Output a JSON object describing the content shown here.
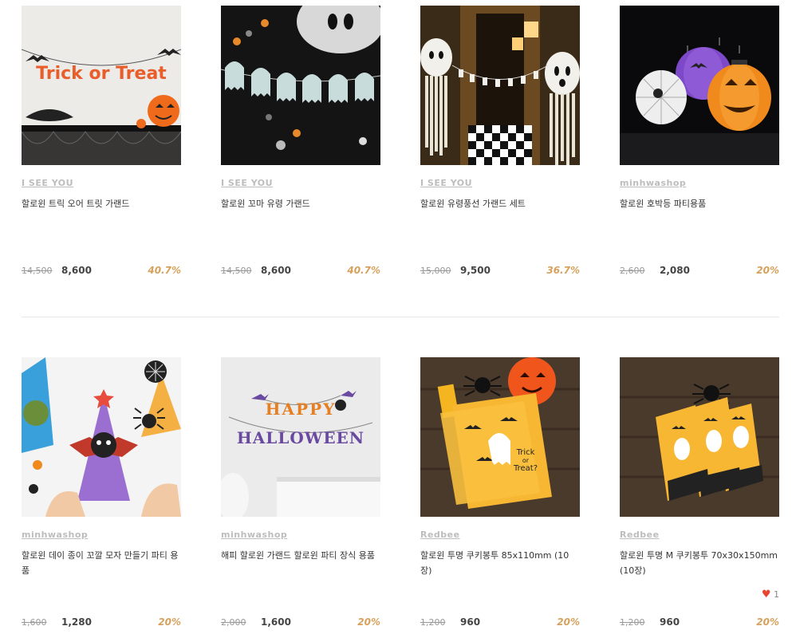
{
  "products_row1": [
    {
      "shop": "I SEE YOU",
      "title": "할로윈 트릭 오어 트릿 가랜드",
      "orig": "14,500",
      "sale": "8,600",
      "discount": "40.7%"
    },
    {
      "shop": "I SEE YOU",
      "title": "할로윈 꼬마 유령 가랜드",
      "orig": "14,500",
      "sale": "8,600",
      "discount": "40.7%"
    },
    {
      "shop": "I SEE YOU",
      "title": "할로윈 유령풍선 가랜드 세트",
      "orig": "15,000",
      "sale": "9,500",
      "discount": "36.7%"
    },
    {
      "shop": "minhwashop",
      "title": "할로윈 호박등 파티용품",
      "orig": "2,600",
      "sale": "2,080",
      "discount": "20%"
    }
  ],
  "products_row2": [
    {
      "shop": "minhwashop",
      "title": "할로윈 데이 종이 꼬깔 모자 만들기 파티 용품",
      "orig": "1,600",
      "sale": "1,280",
      "discount": "20%"
    },
    {
      "shop": "minhwashop",
      "title": "해피 할로윈 가랜드 할로윈 파티 장식 용품",
      "orig": "2,000",
      "sale": "1,600",
      "discount": "20%"
    },
    {
      "shop": "Redbee",
      "title": "할로윈 투명 쿠키봉투 85x110mm (10장)",
      "orig": "1,200",
      "sale": "960",
      "discount": "20%"
    },
    {
      "shop": "Redbee",
      "title": "할로윈 투명 M 쿠키봉투 70x30x150mm (10장)",
      "orig": "1,200",
      "sale": "960",
      "discount": "20%",
      "likes": "1"
    }
  ],
  "image_texts": {
    "trick_or_treat": "Trick or Treat",
    "happy": "HAPPY",
    "halloween": "HALLOWEEN",
    "bag_text_1": "Trick",
    "bag_text_2": "or",
    "bag_text_3": "Treat?"
  },
  "icons": {
    "like": "heart-icon"
  },
  "colors": {
    "discount": "#d6a15c",
    "shop_link": "#bdbdbd",
    "heart": "#e8442e"
  }
}
